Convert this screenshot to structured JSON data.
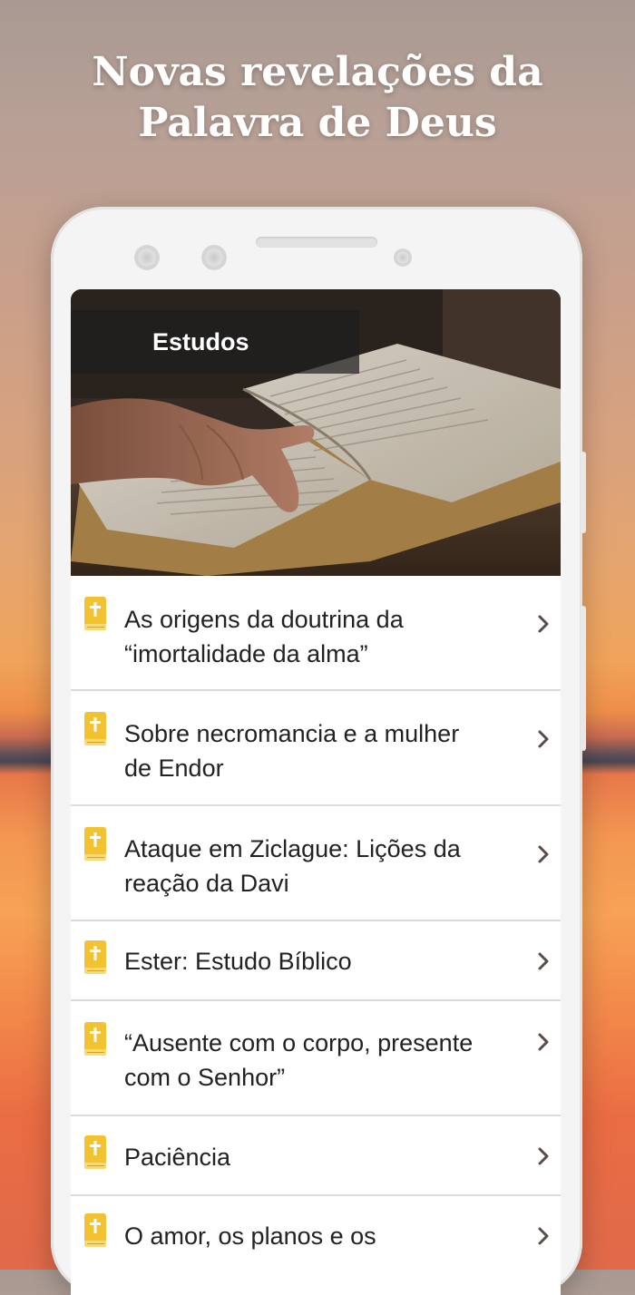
{
  "promo": {
    "headline_line1": "Novas revelações da",
    "headline_line2": "Palavra de Deus"
  },
  "screen": {
    "header_title": "Estudos",
    "header_image": "open-bible-reading-photo",
    "item_icon": "bible-book-icon",
    "chevron_icon": "chevron-right-icon",
    "colors": {
      "icon": "#f2c230",
      "chevron": "#5a4a48",
      "divider": "#dadada"
    },
    "items": [
      {
        "line1": "As origens da doutrina da",
        "line2": "“imortalidade da alma”"
      },
      {
        "line1": "Sobre necromancia e a mulher",
        "line2": "de Endor"
      },
      {
        "line1": "Ataque em Ziclague: Lições da",
        "line2": "reação da Davi"
      },
      {
        "line1": "Ester: Estudo Bíblico",
        "line2": ""
      },
      {
        "line1": "“Ausente com o corpo, presente",
        "line2": "com o Senhor”"
      },
      {
        "line1": "Paciência",
        "line2": ""
      },
      {
        "line1": "O amor, os planos e os",
        "line2": ""
      }
    ]
  }
}
